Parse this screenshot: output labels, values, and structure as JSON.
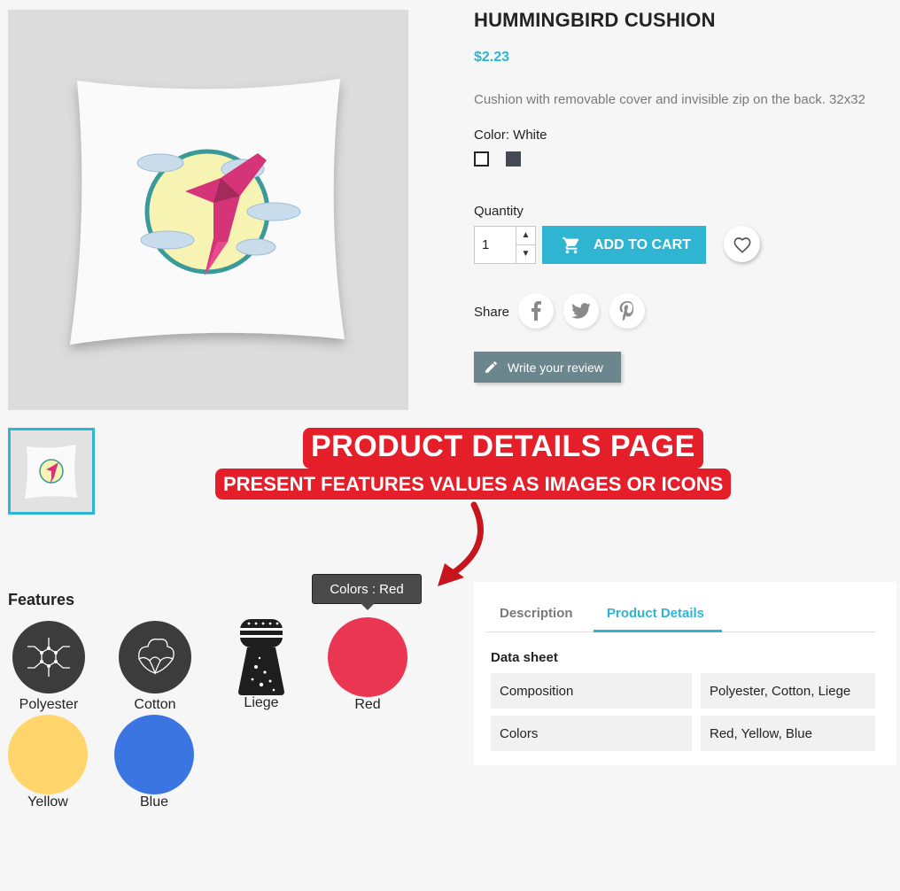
{
  "product": {
    "title": "HUMMINGBIRD CUSHION",
    "price": "$2.23",
    "description": "Cushion with removable cover and invisible zip on the back. 32x32",
    "color_label": "Color: White",
    "swatches": [
      "white",
      "dark-gray"
    ],
    "quantity_label": "Quantity",
    "quantity_value": "1",
    "add_to_cart_label": "ADD TO CART",
    "share_label": "Share",
    "review_label": "Write your review"
  },
  "colors": {
    "accent": "#2fb5d2",
    "review_button": "#6c868e",
    "banner": "#e41f2a",
    "red": "#ea3652",
    "yellow": "#ffd56c",
    "blue": "#3a75e2",
    "dark_icon": "#3c3c3c"
  },
  "banner": {
    "line1": "PRODUCT DETAILS PAGE",
    "line2": "PRESENT FEATURES VALUES AS IMAGES OR ICONS"
  },
  "features": {
    "title": "Features",
    "tooltip": "Colors : Red",
    "items": [
      {
        "label": "Polyester",
        "icon": "polyester-icon"
      },
      {
        "label": "Cotton",
        "icon": "cotton-icon"
      },
      {
        "label": "Liege",
        "icon": "liege-icon"
      },
      {
        "label": "Red",
        "icon": "red-color-circle"
      },
      {
        "label": "Yellow",
        "icon": "yellow-color-circle"
      },
      {
        "label": "Blue",
        "icon": "blue-color-circle"
      }
    ]
  },
  "tabs": {
    "items": [
      "Description",
      "Product Details"
    ],
    "active": "Product Details"
  },
  "data_sheet": {
    "title": "Data sheet",
    "rows": [
      {
        "name": "Composition",
        "value": "Polyester, Cotton, Liege"
      },
      {
        "name": "Colors",
        "value": "Red, Yellow, Blue"
      }
    ]
  }
}
